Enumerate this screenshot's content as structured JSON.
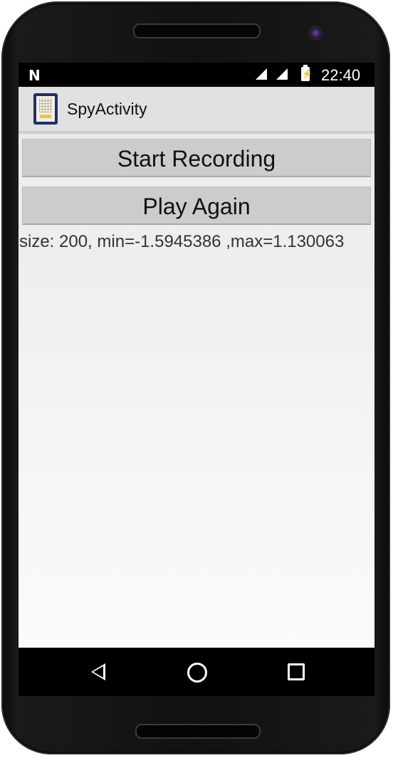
{
  "status_bar": {
    "notification_icon": "N",
    "signal_icon": "cell-signal-icon",
    "battery_icon": "battery-charging-icon",
    "time": "22:40"
  },
  "action_bar": {
    "app_icon": "app-icon",
    "title": "SpyActivity"
  },
  "main": {
    "start_recording_label": "Start Recording",
    "play_again_label": "Play Again",
    "info_text": "size: 200, min=-1.5945386 ,max=1.130063"
  },
  "nav_bar": {
    "back_icon": "back-icon",
    "home_icon": "home-icon",
    "recents_icon": "recents-icon"
  }
}
